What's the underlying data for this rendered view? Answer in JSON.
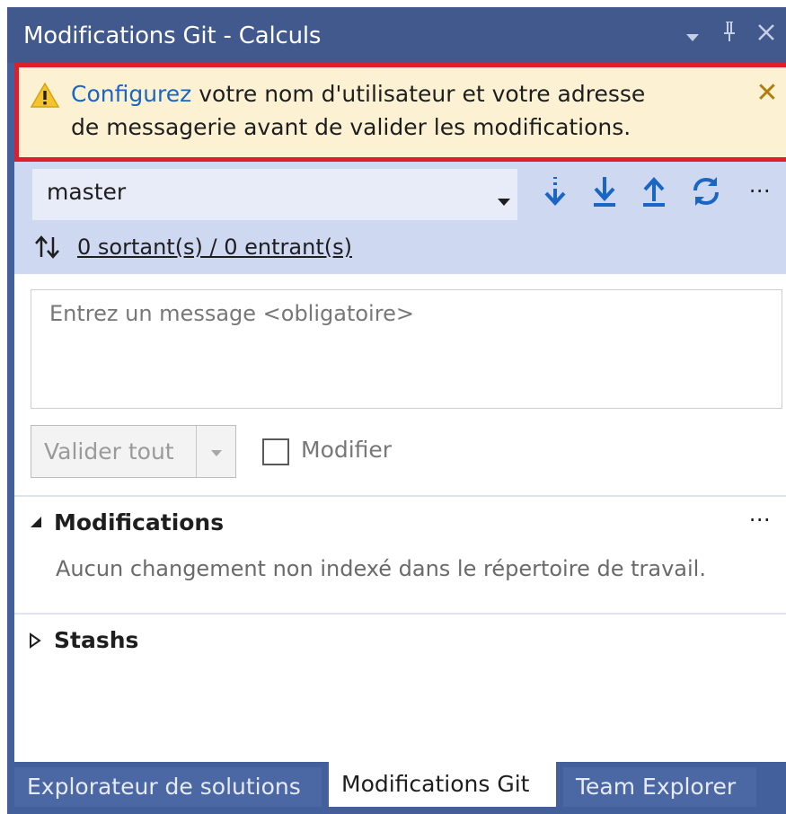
{
  "window": {
    "title": "Modifications Git - Calculs",
    "controls": [
      "menu-caret-icon",
      "pin-icon",
      "close-icon"
    ]
  },
  "infobar": {
    "icon": "warning-icon",
    "link_text": "Configurez",
    "line1_rest": " votre nom d'utilisateur et votre adresse",
    "line2": "de messagerie avant de valider les modifications.",
    "close_glyph": "✕",
    "highlight_color": "#e01d2b"
  },
  "branch": {
    "name": "master",
    "actions": [
      "fetch-icon",
      "pull-icon",
      "push-icon",
      "sync-icon"
    ],
    "more": "⋯"
  },
  "sync": {
    "icon": "sync-arrows-icon",
    "label": "0 sortant(s) / 0 entrant(s)"
  },
  "commit": {
    "message_placeholder": "Entrez un message <obligatoire>",
    "message_value": "",
    "commit_all_label": "Valider tout",
    "amend_label": "Modifier",
    "amend_checked": false
  },
  "sections": {
    "changes": {
      "title": "Modifications",
      "expanded": true,
      "more": "⋯",
      "empty_message": "Aucun changement non indexé dans le répertoire de travail."
    },
    "stashes": {
      "title": "Stashs",
      "expanded": false
    }
  },
  "tabs": [
    {
      "label": "Explorateur de solutions",
      "active": false
    },
    {
      "label": "Modifications Git",
      "active": true
    },
    {
      "label": "Team Explorer",
      "active": false
    }
  ],
  "colors": {
    "title_bar": "#42598e",
    "panel_frame": "#43609c",
    "infobar_bg": "#fcf2d3",
    "branch_area": "#ced8f1",
    "icon_blue": "#1a66c4"
  }
}
